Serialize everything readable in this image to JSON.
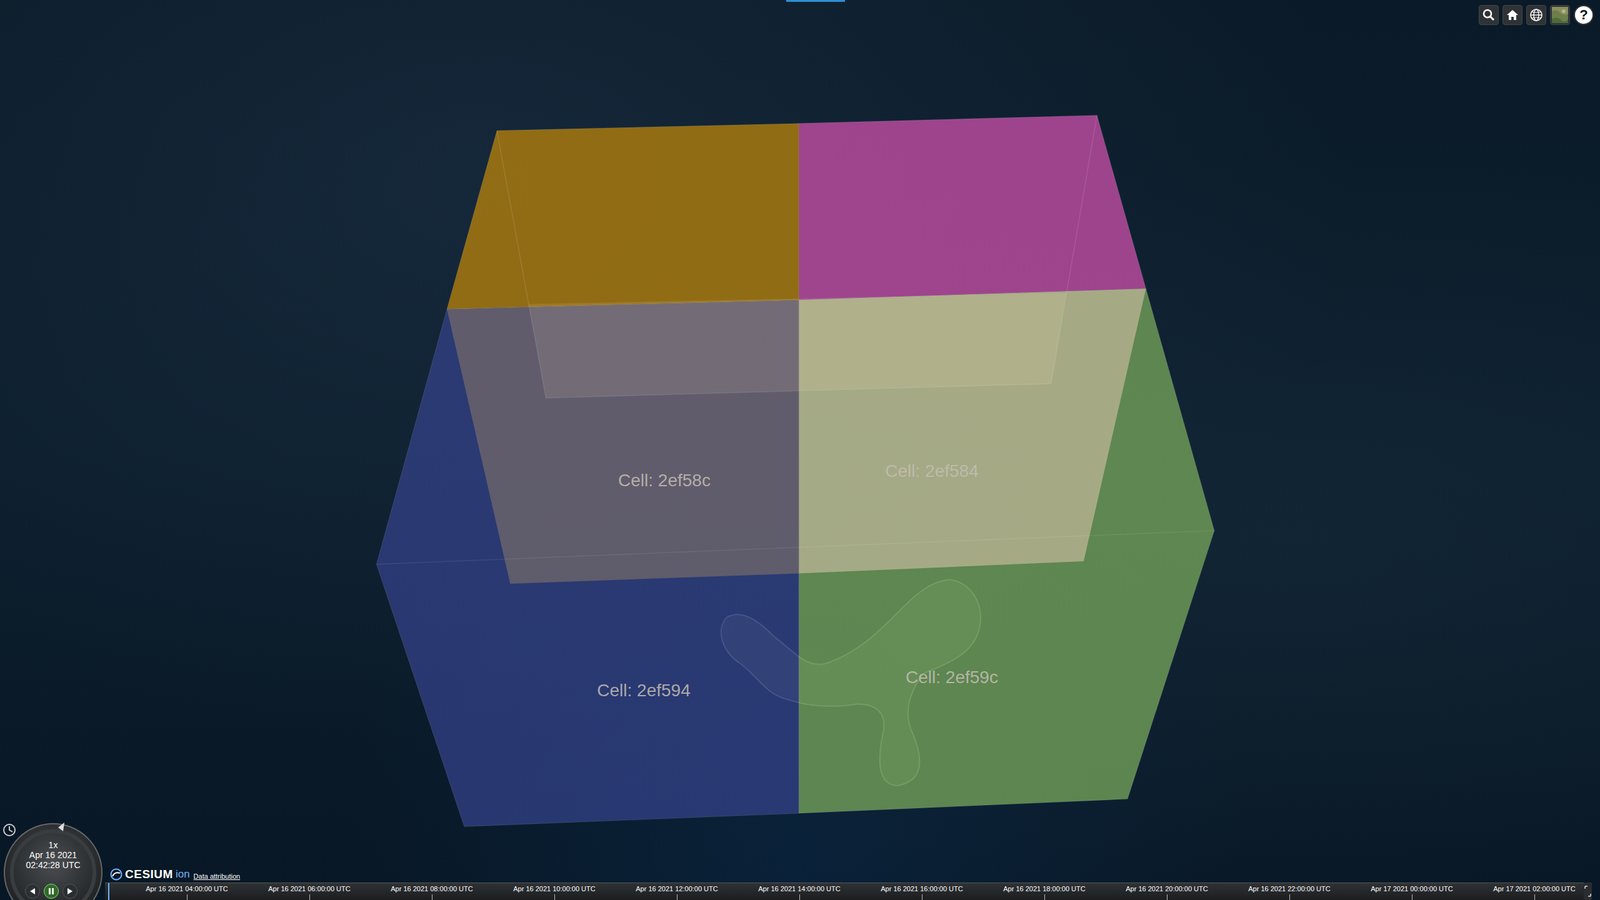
{
  "cells": [
    {
      "label": "Cell: 2ef58c",
      "color": "#b07e0c"
    },
    {
      "label": "Cell: 2ef584",
      "color": "#c24ea4"
    },
    {
      "label": "Cell: 2ef594",
      "color": "#34428a"
    },
    {
      "label": "Cell: 2ef59c",
      "color": "#74a35a"
    }
  ],
  "toolbar": {
    "help": "?"
  },
  "animation": {
    "speed": "1x",
    "date": "Apr 16 2021",
    "time": "02:42:28 UTC",
    "paused": true
  },
  "credits": {
    "logo": "CESIUM",
    "logo_suffix": "ion",
    "attribution": "Data attribution"
  },
  "timeline": {
    "level": 0.002,
    "labels": [
      "Apr 16 2021 04:00:00 UTC",
      "Apr 16 2021 06:00:00 UTC",
      "Apr 16 2021 08:00:00 UTC",
      "Apr 16 2021 10:00:00 UTC",
      "Apr 16 2021 12:00:00 UTC",
      "Apr 16 2021 14:00:00 UTC",
      "Apr 16 2021 16:00:00 UTC",
      "Apr 16 2021 18:00:00 UTC",
      "Apr 16 2021 20:00:00 UTC",
      "Apr 16 2021 22:00:00 UTC",
      "Apr 17 2021 00:00:00 UTC",
      "Apr 17 2021 02:00:00 UTC"
    ]
  }
}
